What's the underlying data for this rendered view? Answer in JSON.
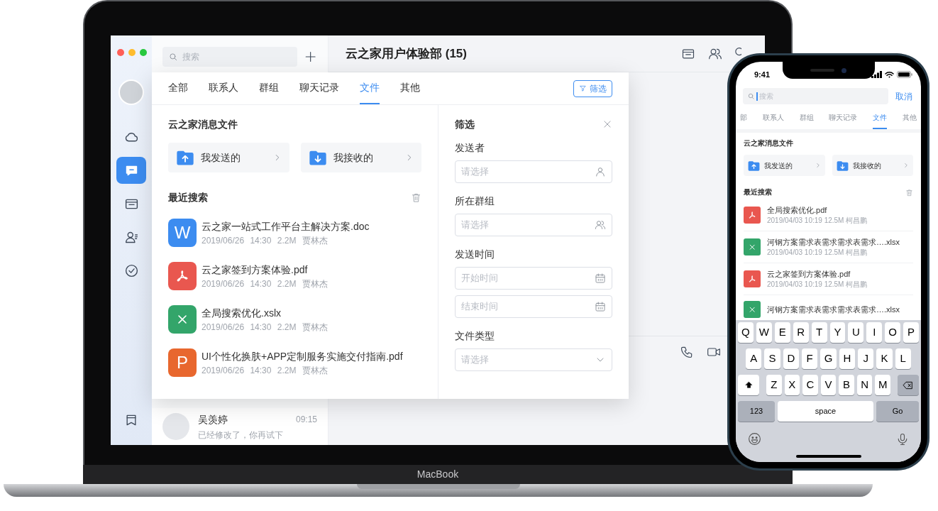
{
  "laptop": {
    "brand_label": "MacBook",
    "app": {
      "rail": {
        "items": [
          {
            "kind": "cloud",
            "selected": false
          },
          {
            "kind": "chat",
            "selected": true
          },
          {
            "kind": "folder",
            "selected": false
          },
          {
            "kind": "contacts",
            "selected": false
          },
          {
            "kind": "tasks",
            "selected": false
          }
        ]
      },
      "search": {
        "placeholder": "搜索"
      },
      "conversations": [
        {
          "name": "吴羡婷",
          "time": "09:15",
          "preview": "已经修改了，你再试下"
        }
      ],
      "chat": {
        "title": "云之家用户体验部 (15)"
      },
      "search_popup": {
        "tabs": [
          {
            "label": "全部",
            "selected": false
          },
          {
            "label": "联系人",
            "selected": false
          },
          {
            "label": "群组",
            "selected": false
          },
          {
            "label": "聊天记录",
            "selected": false
          },
          {
            "label": "文件",
            "selected": true
          },
          {
            "label": "其他",
            "selected": false
          }
        ],
        "filter_button": "筛选",
        "message_files": {
          "title": "云之家消息文件",
          "folders": [
            {
              "kind": "sent",
              "label": "我发送的"
            },
            {
              "kind": "received",
              "label": "我接收的"
            }
          ]
        },
        "recent": {
          "title": "最近搜索",
          "files": [
            {
              "kind": "word",
              "glyph": "W",
              "name": "云之家一站式工作平台主解决方案.doc",
              "meta": "2019/06/26 14:30 2.2M 贾林杰"
            },
            {
              "kind": "pdf",
              "name": "云之家签到方案体验.pdf",
              "meta": "2019/06/26 14:30 2.2M 贾林杰"
            },
            {
              "kind": "excel",
              "name": "全局搜索优化.xslx",
              "meta": "2019/06/26 14:30 2.2M 贾林杰"
            },
            {
              "kind": "ppt",
              "glyph": "P",
              "name": "UI个性化换肤+APP定制服务实施交付指南.pdf",
              "meta": "2019/06/26 14:30 2.2M 贾林杰"
            }
          ]
        },
        "filter": {
          "title": "筛选",
          "groups": [
            {
              "label": "发送者",
              "inputs": [
                {
                  "kind": "person",
                  "placeholder": "请选择"
                }
              ]
            },
            {
              "label": "所在群组",
              "inputs": [
                {
                  "kind": "group",
                  "placeholder": "请选择"
                }
              ]
            },
            {
              "label": "发送时间",
              "inputs": [
                {
                  "kind": "date",
                  "placeholder": "开始时间"
                },
                {
                  "kind": "date",
                  "placeholder": "结束时间"
                }
              ]
            },
            {
              "label": "文件类型",
              "inputs": [
                {
                  "kind": "dropdown",
                  "placeholder": "请选择"
                }
              ]
            }
          ]
        }
      }
    }
  },
  "phone": {
    "status_bar": {
      "time": "9:41"
    },
    "search": {
      "placeholder": "搜索"
    },
    "cancel_button": "取消",
    "tabs": [
      {
        "label": "部",
        "selected": false
      },
      {
        "label": "联系人",
        "selected": false
      },
      {
        "label": "群组",
        "selected": false
      },
      {
        "label": "聊天记录",
        "selected": false
      },
      {
        "label": "文件",
        "selected": true
      },
      {
        "label": "其他",
        "selected": false
      }
    ],
    "message_files": {
      "title": "云之家消息文件",
      "folders": [
        {
          "kind": "sent",
          "label": "我发送的"
        },
        {
          "kind": "received",
          "label": "我接收的"
        }
      ]
    },
    "recent": {
      "title": "最近搜索",
      "files": [
        {
          "kind": "pdf",
          "name": "全局搜索优化.pdf",
          "meta": "2019/04/03 10:19 12.5M 柯昌鹏"
        },
        {
          "kind": "excel",
          "name": "河钢方案需求表需求需求表需求….xlsx",
          "meta": "2019/04/03 10:19 12.5M 柯昌鹏"
        },
        {
          "kind": "pdf",
          "name": "云之家签到方案体验.pdf",
          "meta": "2019/04/03 10:19 12.5M 柯昌鹏"
        },
        {
          "kind": "excel",
          "name": "河钢方案需求表需求需求表需求….xlsx"
        }
      ]
    },
    "keyboard": {
      "rows": [
        {
          "keys": [
            {
              "kind": "letter",
              "label": "Q"
            },
            {
              "kind": "letter",
              "label": "W"
            },
            {
              "kind": "letter",
              "label": "E"
            },
            {
              "kind": "letter",
              "label": "R"
            },
            {
              "kind": "letter",
              "label": "T"
            },
            {
              "kind": "letter",
              "label": "Y"
            },
            {
              "kind": "letter",
              "label": "U"
            },
            {
              "kind": "letter",
              "label": "I"
            },
            {
              "kind": "letter",
              "label": "O"
            },
            {
              "kind": "letter",
              "label": "P"
            }
          ]
        },
        {
          "keys": [
            {
              "kind": "letter",
              "label": "A"
            },
            {
              "kind": "letter",
              "label": "S"
            },
            {
              "kind": "letter",
              "label": "D"
            },
            {
              "kind": "letter",
              "label": "F"
            },
            {
              "kind": "letter",
              "label": "G"
            },
            {
              "kind": "letter",
              "label": "H"
            },
            {
              "kind": "letter",
              "label": "J"
            },
            {
              "kind": "letter",
              "label": "K"
            },
            {
              "kind": "letter",
              "label": "L"
            }
          ]
        },
        {
          "keys": [
            {
              "kind": "shift"
            },
            {
              "kind": "letter",
              "label": "Z"
            },
            {
              "kind": "letter",
              "label": "X"
            },
            {
              "kind": "letter",
              "label": "C"
            },
            {
              "kind": "letter",
              "label": "V"
            },
            {
              "kind": "letter",
              "label": "B"
            },
            {
              "kind": "letter",
              "label": "N"
            },
            {
              "kind": "letter",
              "label": "M"
            },
            {
              "kind": "backspace"
            }
          ]
        },
        {
          "keys": [
            {
              "kind": "mode",
              "label": "123"
            },
            {
              "kind": "space",
              "label": "space"
            },
            {
              "kind": "action",
              "label": "Go"
            }
          ]
        }
      ]
    }
  }
}
